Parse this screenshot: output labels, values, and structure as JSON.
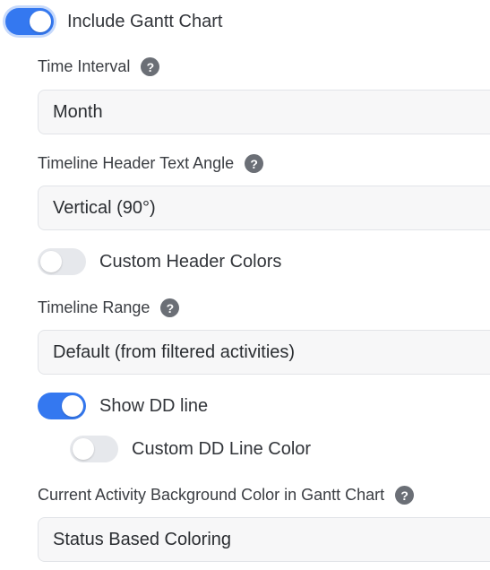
{
  "gantt": {
    "include_toggle": {
      "label": "Include Gantt Chart",
      "state": "on"
    },
    "time_interval": {
      "label": "Time Interval",
      "value": "Month"
    },
    "header_text_angle": {
      "label": "Timeline Header Text Angle",
      "value": "Vertical (90°)"
    },
    "custom_header_colors": {
      "label": "Custom Header Colors",
      "state": "off"
    },
    "timeline_range": {
      "label": "Timeline Range",
      "value": "Default (from filtered activities)"
    },
    "show_dd_line": {
      "label": "Show DD line",
      "state": "on"
    },
    "custom_dd_line_color": {
      "label": "Custom DD Line Color",
      "state": "off"
    },
    "current_activity_bg": {
      "label": "Current Activity Background Color in Gantt Chart",
      "value": "Status Based Coloring"
    }
  },
  "help_icon_glyph": "?",
  "colors": {
    "accent": "#3478f0",
    "toggle_off": "#e6e8ec",
    "help_icon": "#6b6f76",
    "select_bg": "#f7f7f8"
  }
}
